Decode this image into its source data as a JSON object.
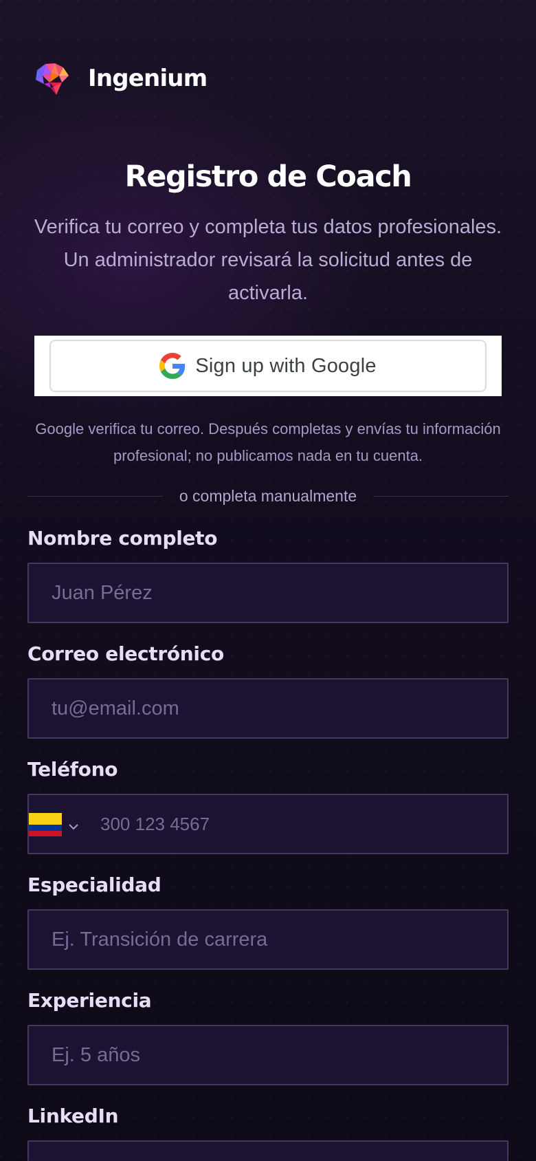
{
  "brand": {
    "name": "Ingenium",
    "logo_icon": "brain-logo-icon"
  },
  "header": {
    "title": "Registro de Coach",
    "subtitle": "Verifica tu correo y completa tus datos profesionales. Un administrador revisará la solicitud antes de activarla."
  },
  "google": {
    "button_label": "Sign up with Google",
    "icon": "google-g-icon",
    "note": "Google verifica tu correo. Después completas y envías tu información profesional; no publicamos nada en tu cuenta."
  },
  "divider": {
    "label": "o completa manualmente"
  },
  "form": {
    "full_name": {
      "label": "Nombre completo",
      "placeholder": "Juan Pérez",
      "value": ""
    },
    "email": {
      "label": "Correo electrónico",
      "placeholder": "tu@email.com",
      "value": ""
    },
    "phone": {
      "label": "Teléfono",
      "placeholder": "300 123 4567",
      "value": "",
      "country_flag_icon": "colombia-flag-icon",
      "dropdown_icon": "chevron-down-icon"
    },
    "specialty": {
      "label": "Especialidad",
      "placeholder": "Ej. Transición de carrera",
      "value": ""
    },
    "experience": {
      "label": "Experiencia",
      "placeholder": "Ej. 5 años",
      "value": ""
    },
    "linkedin": {
      "label": "LinkedIn",
      "placeholder": "",
      "value": ""
    }
  },
  "colors": {
    "background": "#0e0a17",
    "input_background": "#1b1331",
    "input_border": "#443a5e",
    "label_text": "#e6def7",
    "muted_text": "#b9acd7",
    "placeholder_text": "#776c94"
  }
}
